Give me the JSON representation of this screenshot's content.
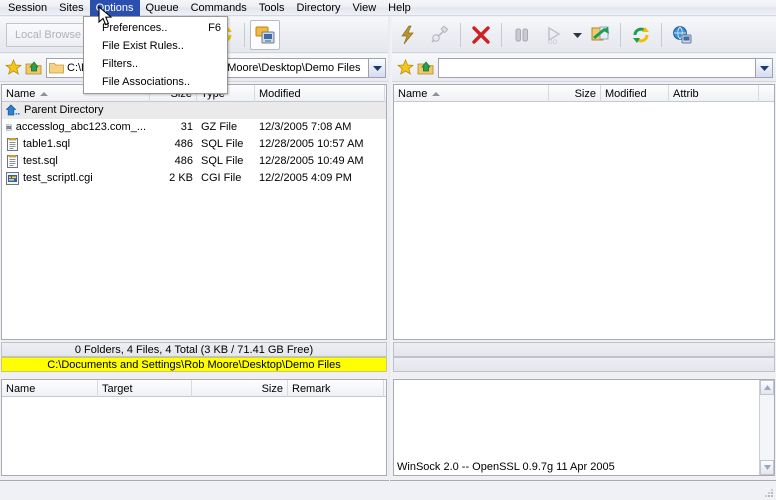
{
  "menubar": {
    "items": [
      {
        "label": "Session",
        "active": false
      },
      {
        "label": "Sites",
        "active": false
      },
      {
        "label": "Options",
        "active": true
      },
      {
        "label": "Queue",
        "active": false
      },
      {
        "label": "Commands",
        "active": false
      },
      {
        "label": "Tools",
        "active": false
      },
      {
        "label": "Directory",
        "active": false
      },
      {
        "label": "View",
        "active": false
      },
      {
        "label": "Help",
        "active": false
      }
    ]
  },
  "options_menu": {
    "items": [
      {
        "label": "Preferences..",
        "shortcut": "F6"
      },
      {
        "label": "File Exist Rules..",
        "shortcut": ""
      },
      {
        "label": "Filters..",
        "shortcut": ""
      },
      {
        "label": "File Associations..",
        "shortcut": ""
      }
    ]
  },
  "left_toolbar": {
    "local_browse_label": "Local Browse",
    "buttons": [
      {
        "name": "refresh-icon",
        "label": "Refresh"
      },
      {
        "name": "remote-view-icon",
        "label": "Remote View"
      }
    ]
  },
  "right_toolbar": {
    "buttons": [
      {
        "name": "connect-lightning-icon",
        "label": "Connect"
      },
      {
        "name": "disconnect-plug-icon",
        "label": "Disconnect"
      },
      {
        "name": "abort-x-icon",
        "label": "Abort"
      },
      {
        "name": "pause-icon",
        "label": "Pause"
      },
      {
        "name": "resume-go-icon",
        "label": "Resume"
      },
      {
        "name": "transfer-mode-dropdown-arrow",
        "label": "Transfer Mode"
      },
      {
        "name": "transfer-icon",
        "label": "Transfer"
      },
      {
        "name": "refresh-icon",
        "label": "Refresh"
      },
      {
        "name": "network-globe-icon",
        "label": "Network"
      }
    ]
  },
  "left_pathbar": {
    "favorite_icon": "star-icon",
    "up_icon": "up-folder-icon",
    "path_value": "C:\\Documents and Settings\\Rob Moore\\Desktop\\Demo Files",
    "path_visible_text": "o Moore\\Desktop\\Demo File:"
  },
  "right_pathbar": {
    "favorite_icon": "star-icon",
    "up_icon": "up-folder-icon",
    "path_value": ""
  },
  "left_pane": {
    "columns": [
      "Name",
      "Size",
      "Type",
      "Modified"
    ],
    "sorted_column": "Name",
    "parent_row_label": "Parent Directory",
    "rows": [
      {
        "icon": "gz-file-icon",
        "name": "accesslog_abc123.com_...",
        "size": "31",
        "type": "GZ File",
        "modified": "12/3/2005 7:08 AM"
      },
      {
        "icon": "sql-file-icon",
        "name": "table1.sql",
        "size": "486",
        "type": "SQL File",
        "modified": "12/28/2005 10:57 AM"
      },
      {
        "icon": "sql-file-icon",
        "name": "test.sql",
        "size": "486",
        "type": "SQL File",
        "modified": "12/28/2005 10:49 AM"
      },
      {
        "icon": "cgi-file-icon",
        "name": "test_scriptl.cgi",
        "size": "2 KB",
        "type": "CGI File",
        "modified": "12/2/2005 4:09 PM"
      }
    ]
  },
  "right_pane": {
    "columns": [
      "Name",
      "Size",
      "Modified",
      "Attrib"
    ],
    "sorted_column": "Name",
    "rows": []
  },
  "left_status": {
    "summary": "0 Folders, 4 Files, 4 Total (3 KB / 71.41 GB Free)",
    "path": "C:\\Documents and Settings\\Rob Moore\\Desktop\\Demo Files"
  },
  "right_status": {
    "line1": "",
    "line2": ""
  },
  "queue_pane": {
    "columns": [
      "Name",
      "Target",
      "Size",
      "Remark"
    ],
    "rows": []
  },
  "log_pane": {
    "lines": [
      "WinSock 2.0 -- OpenSSL 0.9.7g 11 Apr 2005"
    ]
  },
  "bottom_status": {
    "left_text": "",
    "right_text": ""
  },
  "colors": {
    "menu_highlight": "#2a4faf",
    "path_highlight": "#ffff00",
    "abort_red": "#cc2222",
    "selection_gray": "#eaeaea"
  }
}
